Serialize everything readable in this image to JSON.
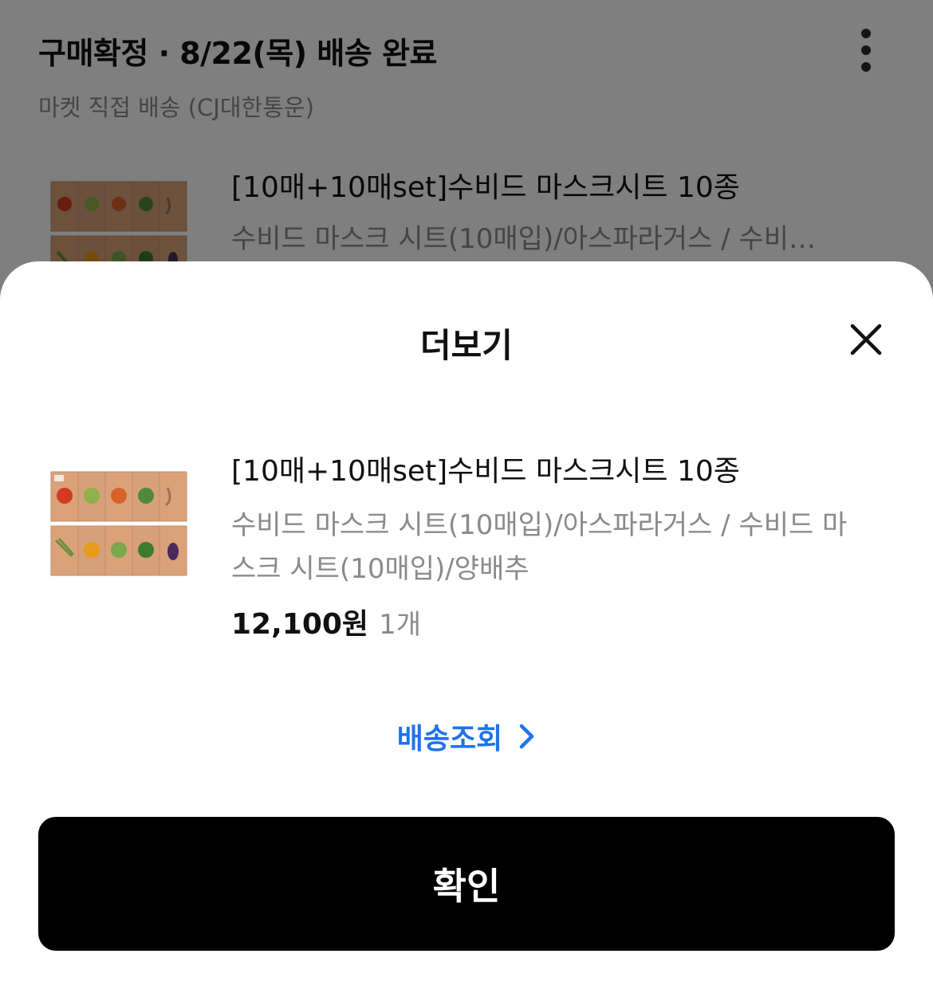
{
  "background": {
    "header": "구매확정 · 8/22(목) 배송 완료",
    "delivery_info": "마켓 직접 배송 (CJ대한통운)",
    "product_title": "[10매+10매set]수비드 마스크시트 10종",
    "product_option": "수비드 마스크 시트(10매입)/아스파라거스 / 수비드 마스크 시트(10매입)/양배추",
    "more_icon": "more-vertical-icon"
  },
  "sheet": {
    "title": "더보기",
    "close_icon": "close-icon",
    "item": {
      "image": "product-thumbnail",
      "title": "[10매+10매set]수비드 마스크시트 10종",
      "option": "수비드 마스크 시트(10매입)/아스파라거스 / 수비드 마스크 시트(10매입)/양배추",
      "price": "12,100원",
      "quantity": "1개"
    },
    "track_link": {
      "label": "배송조회",
      "icon": "chevron-right-icon"
    },
    "confirm_label": "확인"
  },
  "colors": {
    "link_blue": "#1f73e8",
    "button_black": "#000000",
    "secondary_text": "#8a8a8a",
    "dim_overlay": "rgba(0,0,0,0.5)"
  }
}
